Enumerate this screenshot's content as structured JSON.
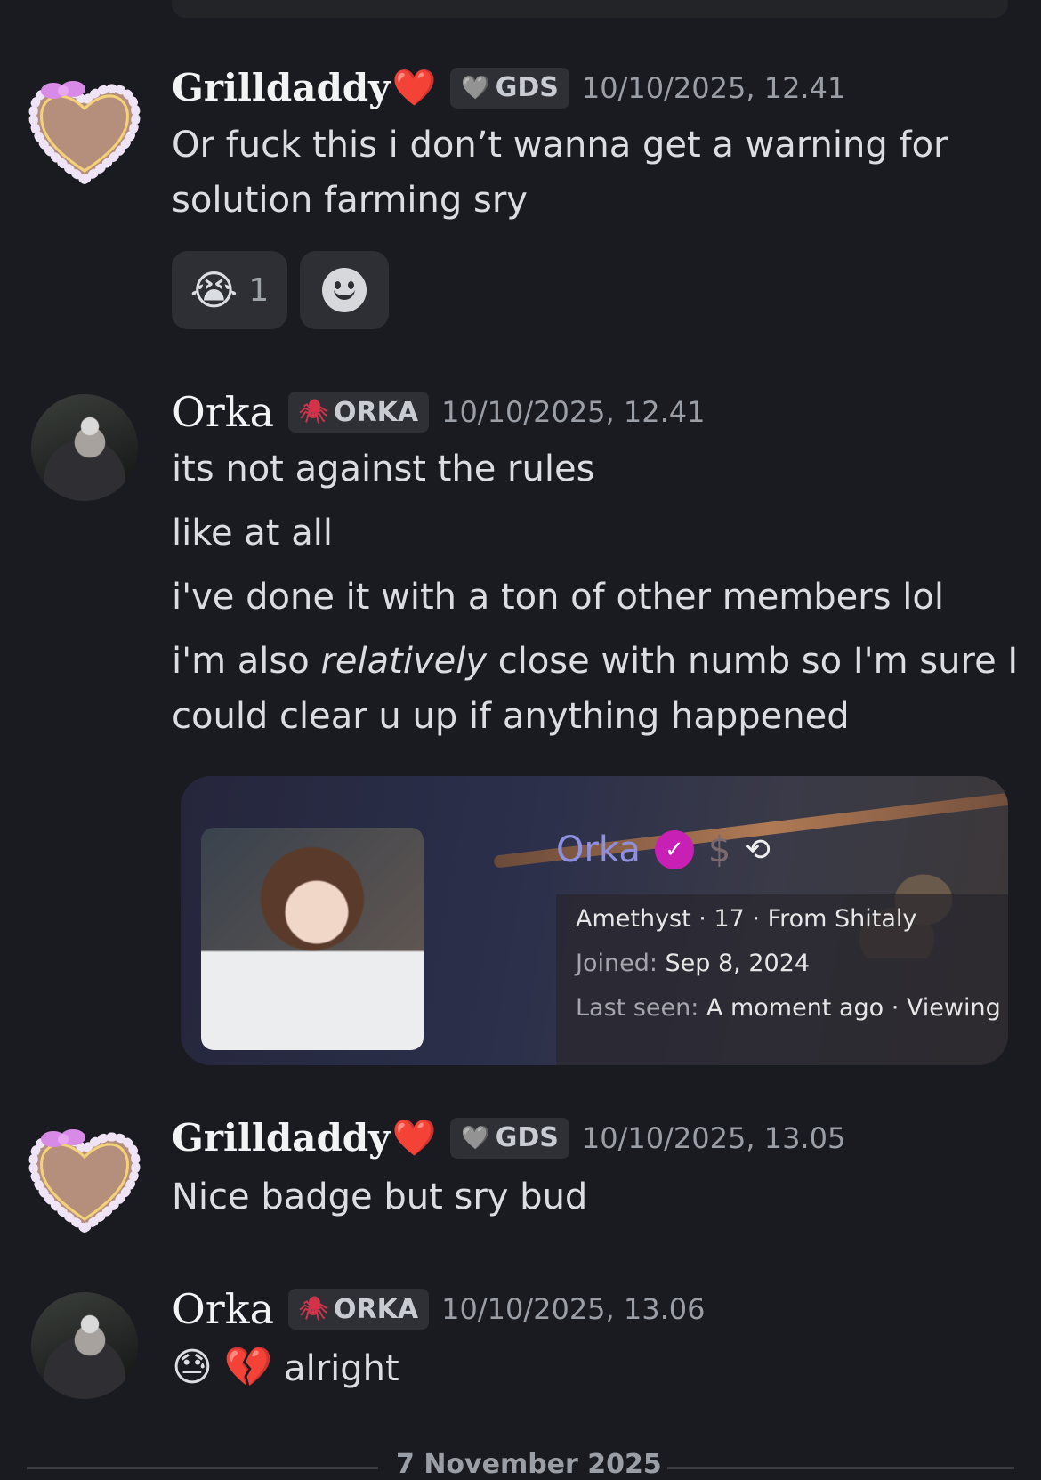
{
  "messages": [
    {
      "username": "Grilldaddy",
      "name_emoji": "❤️",
      "tag_icon": "🩶",
      "tag": "GDS",
      "timestamp": "10/10/2025, 12.41",
      "lines": [
        "Or fuck this i don’t wanna get a warning for",
        "solution farming sry"
      ],
      "reactions": [
        {
          "emoji": "😭",
          "count": "1"
        }
      ]
    },
    {
      "username": "Orka",
      "tag_icon": "🕷",
      "tag": "ORKA",
      "timestamp": "10/10/2025, 12.41",
      "lines": [
        "its not against the rules",
        "like at all",
        "i've done it with a ton of other members lol"
      ],
      "line4_pre": "i'm also ",
      "line4_em": "relatively",
      "line4_post": " close with numb so I'm sure I",
      "line5": "could clear u up if anything happened",
      "embed": {
        "name": "Orka",
        "info1": "Amethyst · 17 · From Shitaly",
        "joined_label": "Joined:",
        "joined_value": " Sep 8, 2024",
        "lastseen_label": "Last seen:",
        "lastseen_value": " A moment ago · Viewing me"
      }
    },
    {
      "username": "Grilldaddy",
      "name_emoji": "❤️",
      "tag_icon": "🩶",
      "tag": "GDS",
      "timestamp": "10/10/2025, 13.05",
      "lines": [
        "Nice badge but sry bud"
      ]
    },
    {
      "username": "Orka",
      "tag_icon": "🕷",
      "tag": "ORKA",
      "timestamp": "10/10/2025, 13.06",
      "emoji1": "😓",
      "emoji2": "💔",
      "text": " alright"
    }
  ],
  "date_divider": "7 November 2025"
}
